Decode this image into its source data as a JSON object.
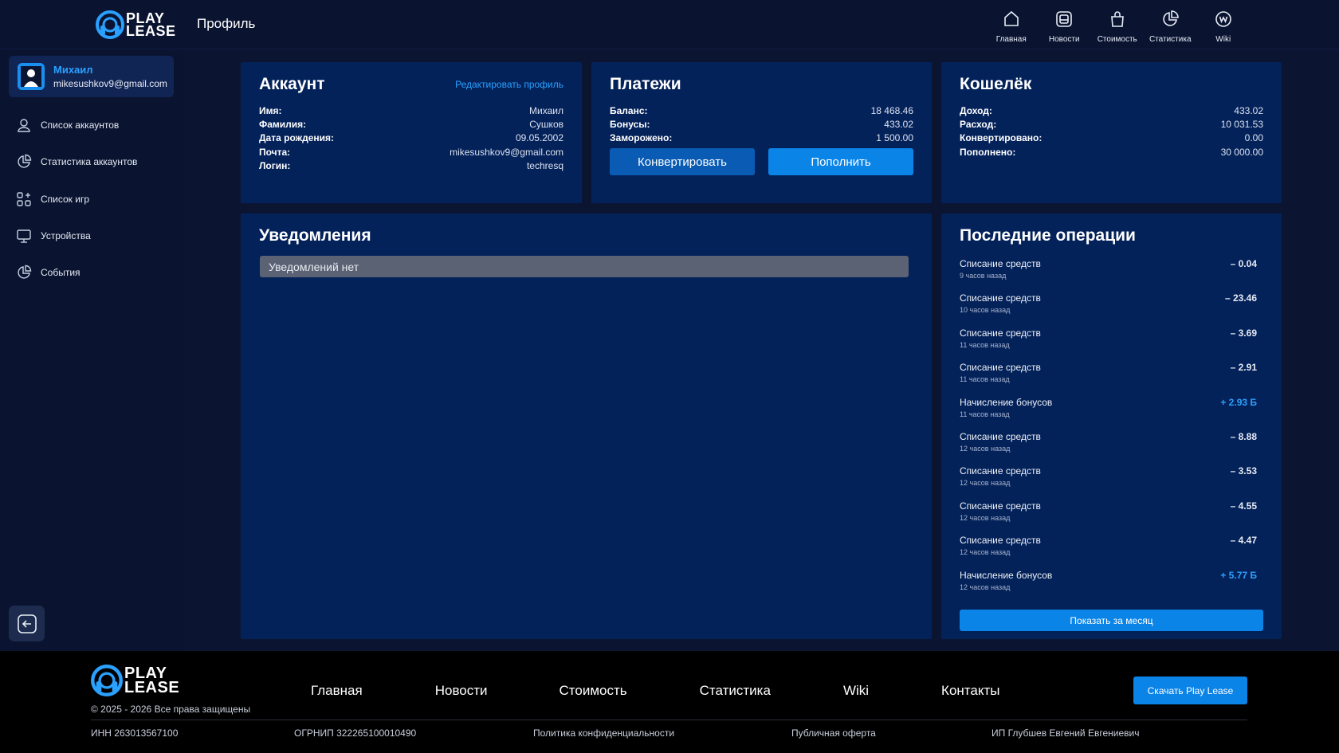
{
  "brand": {
    "line1": "PLAY",
    "line2": "LEASE"
  },
  "header": {
    "page_title": "Профиль",
    "nav": [
      {
        "label": "Главная",
        "icon": "home-icon"
      },
      {
        "label": "Новости",
        "icon": "news-icon"
      },
      {
        "label": "Стоимость",
        "icon": "bag-icon"
      },
      {
        "label": "Статистика",
        "icon": "pie-chart-icon"
      },
      {
        "label": "Wiki",
        "icon": "wiki-icon"
      }
    ]
  },
  "sidebar": {
    "user": {
      "name": "Михаил",
      "email": "mikesushkov9@gmail.com"
    },
    "items": [
      {
        "label": "Список аккаунтов",
        "icon": "user-icon"
      },
      {
        "label": "Статистика аккаунтов",
        "icon": "pie-chart-icon"
      },
      {
        "label": "Список игр",
        "icon": "grid-add-icon"
      },
      {
        "label": "Устройства",
        "icon": "monitor-icon"
      },
      {
        "label": "События",
        "icon": "pie-chart-icon"
      }
    ]
  },
  "account": {
    "title": "Аккаунт",
    "edit_label": "Редактировать профиль",
    "rows": [
      {
        "key": "Имя:",
        "value": "Михаил"
      },
      {
        "key": "Фамилия:",
        "value": "Сушков"
      },
      {
        "key": "Дата рождения:",
        "value": "09.05.2002"
      },
      {
        "key": "Почта:",
        "value": "mikesushkov9@gmail.com"
      },
      {
        "key": "Логин:",
        "value": "techresq"
      }
    ]
  },
  "payments": {
    "title": "Платежи",
    "rows": [
      {
        "key": "Баланс:",
        "value": "18 468.46"
      },
      {
        "key": "Бонусы:",
        "value": "433.02"
      },
      {
        "key": "Заморожено:",
        "value": "1 500.00"
      }
    ],
    "convert_label": "Конвертировать",
    "topup_label": "Пополнить"
  },
  "wallet": {
    "title": "Кошелёк",
    "rows": [
      {
        "key": "Доход:",
        "value": "433.02"
      },
      {
        "key": "Расход:",
        "value": "10 031.53"
      },
      {
        "key": "Конвертировано:",
        "value": "0.00"
      },
      {
        "key": "Пополнено:",
        "value": "30 000.00"
      }
    ]
  },
  "notifications": {
    "title": "Уведомления",
    "empty_text": "Уведомлений нет"
  },
  "operations": {
    "title": "Последние операции",
    "items": [
      {
        "title": "Списание средств",
        "time": "9 часов назад",
        "amount": "– 0.04",
        "bonus": false
      },
      {
        "title": "Списание средств",
        "time": "10 часов назад",
        "amount": "– 23.46",
        "bonus": false
      },
      {
        "title": "Списание средств",
        "time": "11 часов назад",
        "amount": "– 3.69",
        "bonus": false
      },
      {
        "title": "Списание средств",
        "time": "11 часов назад",
        "amount": "– 2.91",
        "bonus": false
      },
      {
        "title": "Начисление бонусов",
        "time": "11 часов назад",
        "amount": "+ 2.93 Б",
        "bonus": true
      },
      {
        "title": "Списание средств",
        "time": "12 часов назад",
        "amount": "– 8.88",
        "bonus": false
      },
      {
        "title": "Списание средств",
        "time": "12 часов назад",
        "amount": "– 3.53",
        "bonus": false
      },
      {
        "title": "Списание средств",
        "time": "12 часов назад",
        "amount": "– 4.55",
        "bonus": false
      },
      {
        "title": "Списание средств",
        "time": "12 часов назад",
        "amount": "– 4.47",
        "bonus": false
      },
      {
        "title": "Начисление бонусов",
        "time": "12 часов назад",
        "amount": "+ 5.77 Б",
        "bonus": true
      }
    ],
    "month_label": "Показать за месяц"
  },
  "footer": {
    "copyright": "© 2025 - 2026 Все права защищены",
    "nav": [
      "Главная",
      "Новости",
      "Стоимость",
      "Статистика",
      "Wiki",
      "Контакты"
    ],
    "download_label": "Скачать Play Lease",
    "legal": [
      "ИНН 263013567100",
      "ОГРНИП 322265100010490",
      "Политика конфиденциальности",
      "Публичная оферта",
      "ИП Глубшев Евгений Евгениевич"
    ]
  },
  "colors": {
    "accent": "#2aa1ff",
    "button": "#0b84e8",
    "panel": "#04225a",
    "background": "#0b1532"
  }
}
